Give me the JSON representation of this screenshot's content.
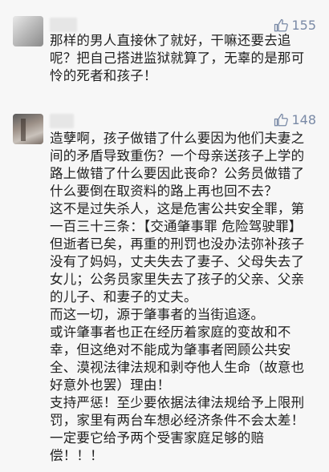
{
  "comments": [
    {
      "likes": "155",
      "lines": [
        "那样的男人直接休了就好，干嘛还要去追",
        "呢？把自己搭进监狱就算了，无辜的是那可",
        "怜的死者和孩子！"
      ]
    },
    {
      "likes": "148",
      "lines": [
        "造孽啊，孩子做错了什么要因为他们夫妻之",
        "间的矛盾导致重伤？一个母亲送孩子上学的",
        "路上做错了什么要因此丧命？公务员做错了",
        "什么要倒在取资料的路上再也回不去？",
        "这不是过失杀人，这是危害公共安全罪，第",
        "一百三十三条：【交通肇事罪 危险驾驶罪】",
        "但逝者已矣，再重的刑罚也没办法弥补孩子",
        "没有了妈妈，丈夫失去了妻子、父母失去了",
        "女儿；公务员家里失去了孩子的父亲、父亲",
        "的儿子、和妻子的丈夫。",
        "而这一切，源于肇事者的当街追逐。",
        "或许肇事者也正在经历着家庭的变故和不",
        "幸，但这绝对不能成为肇事者罔顾公共安",
        "全、漠视法律法规和剥夺他人生命（故意也",
        "好意外也罢）理由！",
        "支持严惩！至少要依据法律法规给予上限刑",
        "罚，家里有两台车想必经济条件不会太差！",
        "一定要它给予两个受害家庭足够的赔",
        "偿！！！"
      ]
    }
  ]
}
